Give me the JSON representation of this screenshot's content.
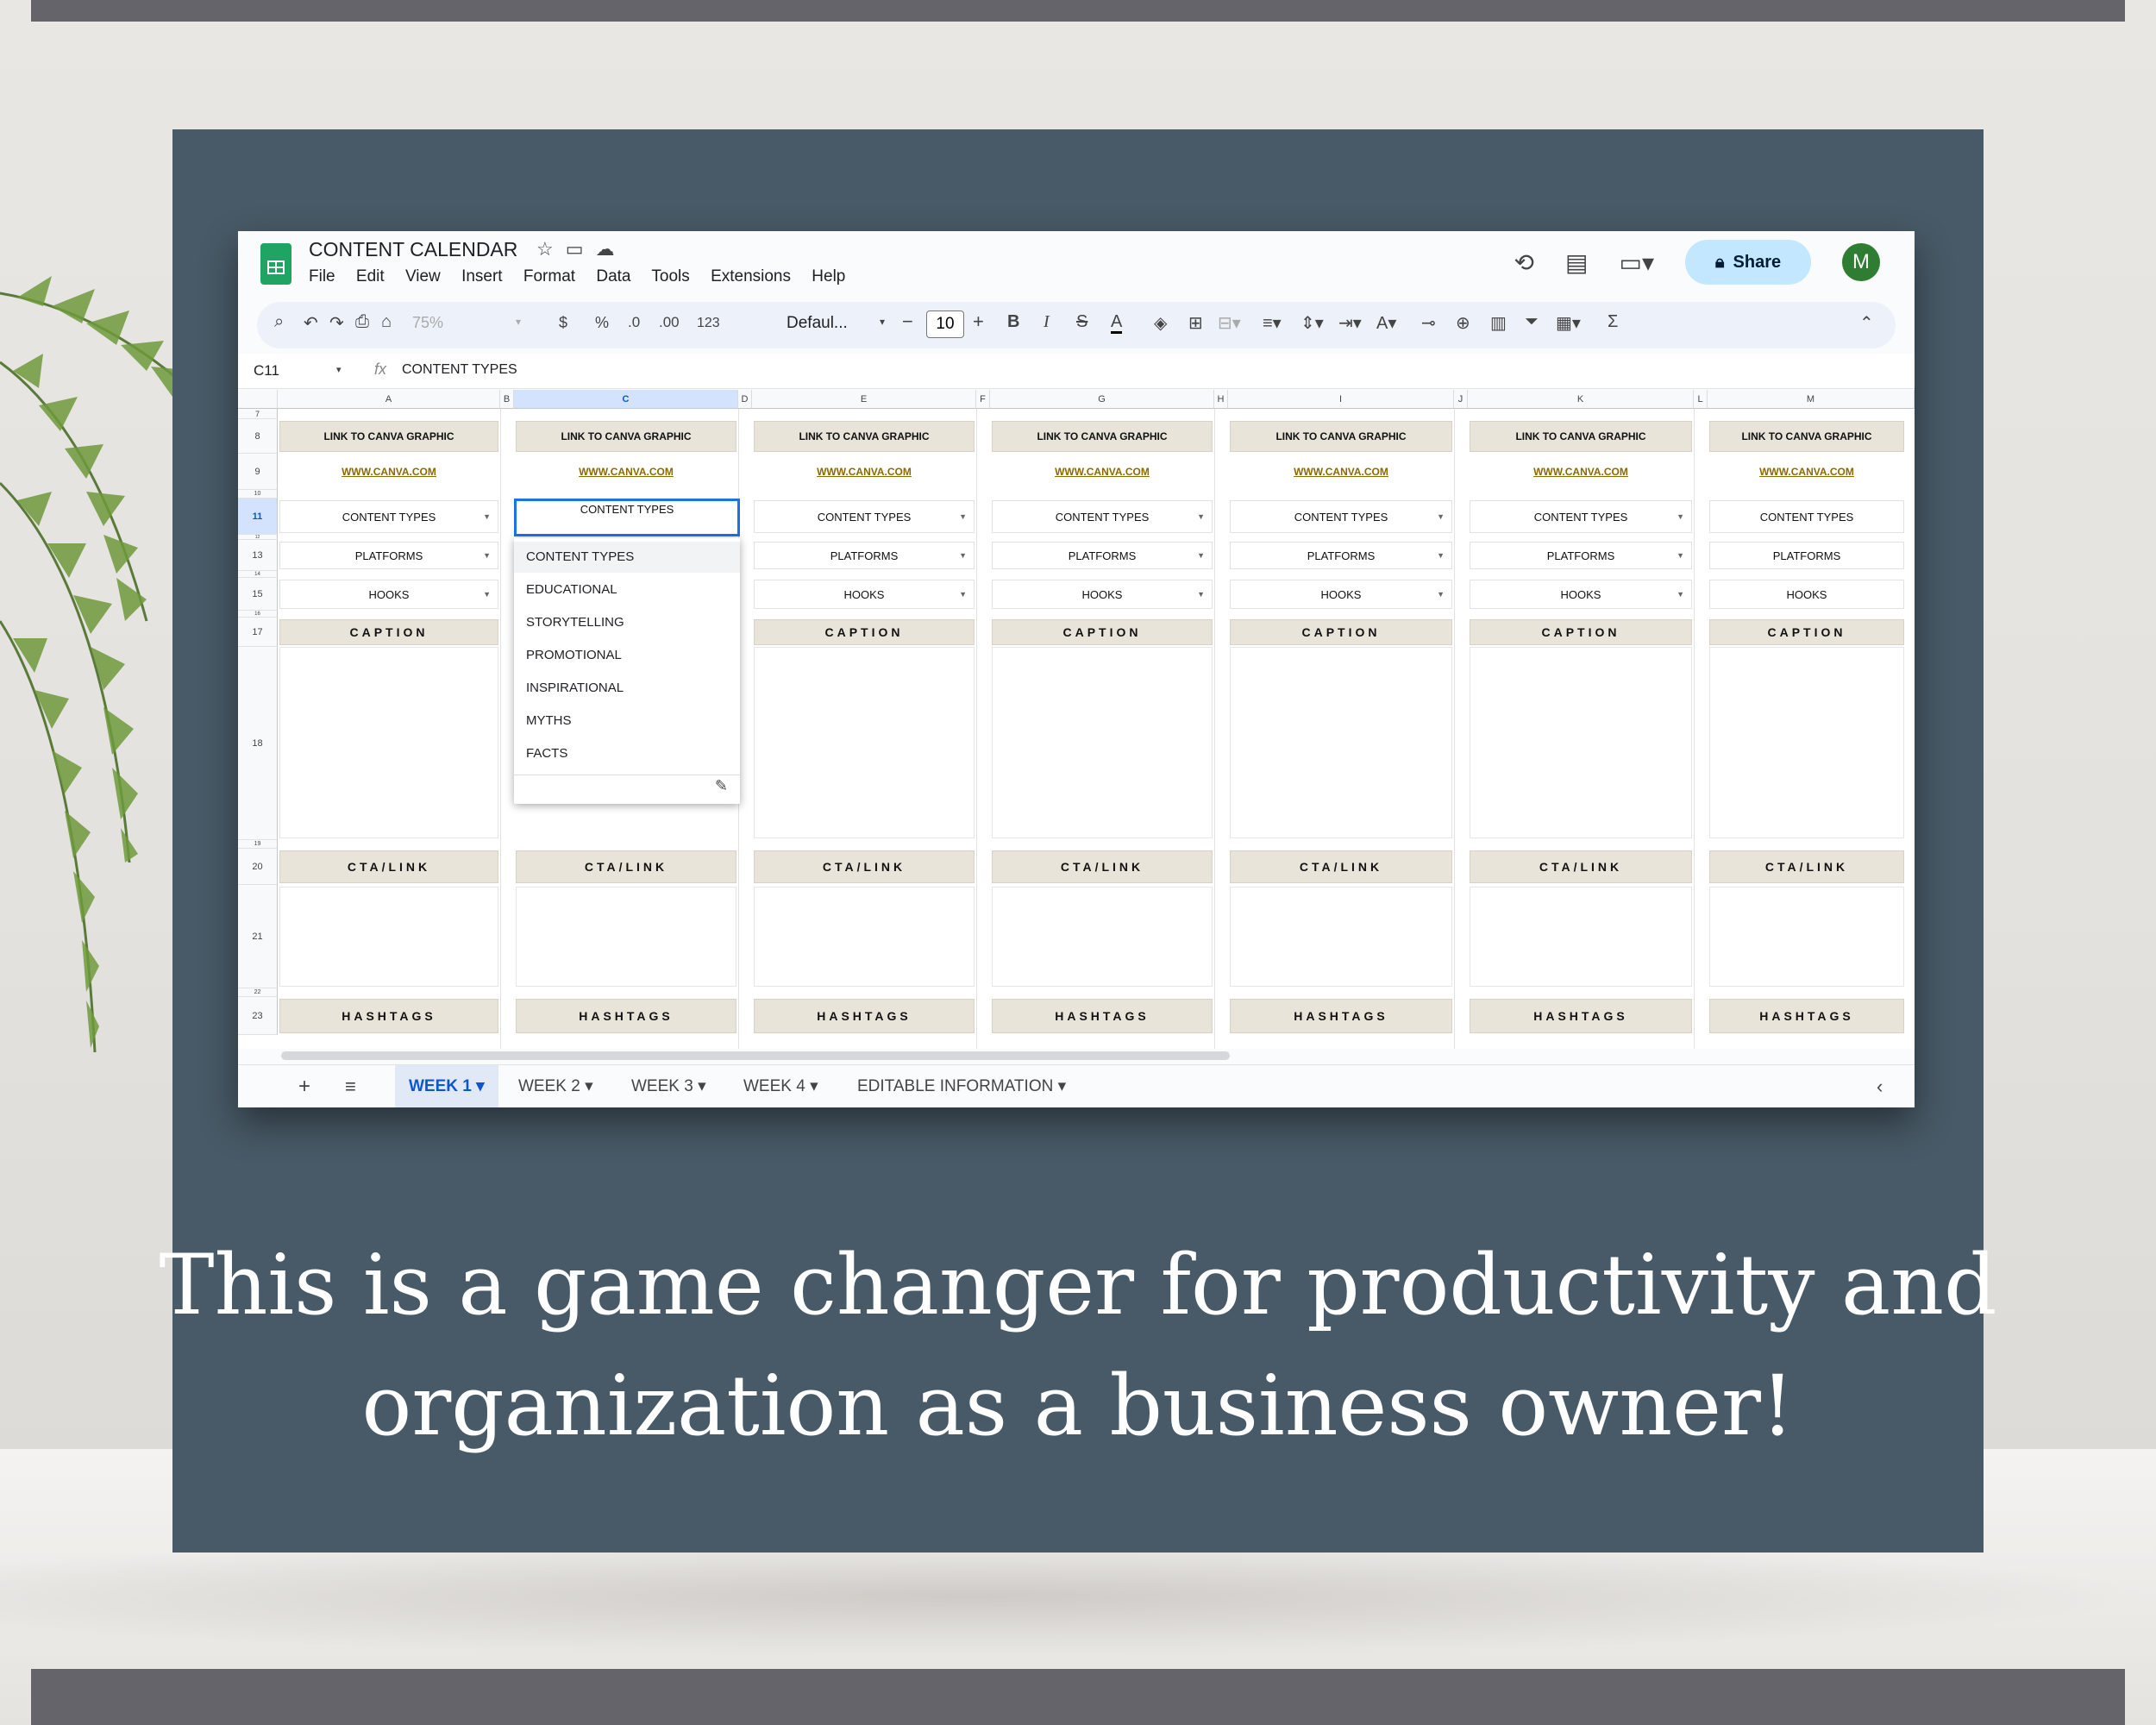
{
  "headline": {
    "line1": "This is a game changer for productivity and",
    "line2": "organization as a business owner!"
  },
  "app": {
    "title": "CONTENT CALENDAR",
    "menu": [
      "File",
      "Edit",
      "View",
      "Insert",
      "Format",
      "Data",
      "Tools",
      "Extensions",
      "Help"
    ],
    "share_label": "Share",
    "avatar_letter": "M"
  },
  "toolbar": {
    "zoom": "75%",
    "currency": "$",
    "percent": "%",
    "decrease_decimal": ".0",
    "increase_decimal": ".00",
    "number_format": "123",
    "font": "Defaul...",
    "font_size": "10"
  },
  "formula_bar": {
    "cell_ref": "C11",
    "fx": "fx",
    "value": "CONTENT TYPES"
  },
  "columns": [
    "A",
    "B",
    "C",
    "D",
    "E",
    "F",
    "G",
    "H",
    "I",
    "J",
    "K",
    "L",
    "M"
  ],
  "rows": [
    "7",
    "8",
    "9",
    "10",
    "11",
    "12",
    "13",
    "14",
    "15",
    "16",
    "17",
    "18",
    "19",
    "20",
    "21",
    "22",
    "23"
  ],
  "cells": {
    "link_header": "LINK TO CANVA GRAPHIC",
    "url": "WWW.CANVA.COM",
    "content_types": "CONTENT TYPES",
    "platforms": "PLATFORMS",
    "hooks": "HOOKS",
    "caption": "CAPTION",
    "cta": "CTA/LINK",
    "hashtags": "HASHTAGS"
  },
  "dropdown": {
    "options": [
      "CONTENT TYPES",
      "EDUCATIONAL",
      "STORYTELLING",
      "PROMOTIONAL",
      "INSPIRATIONAL",
      "MYTHS",
      "FACTS"
    ]
  },
  "sheet_tabs": [
    "WEEK 1",
    "WEEK 2",
    "WEEK 3",
    "WEEK 4",
    "EDITABLE INFORMATION"
  ],
  "active_tab": "WEEK 1",
  "colors": {
    "panel": "#485a67",
    "header_cell": "#e9e4da",
    "accent": "#1a73e8",
    "share_bg": "#c2e7ff",
    "avatar": "#2e7d32"
  }
}
